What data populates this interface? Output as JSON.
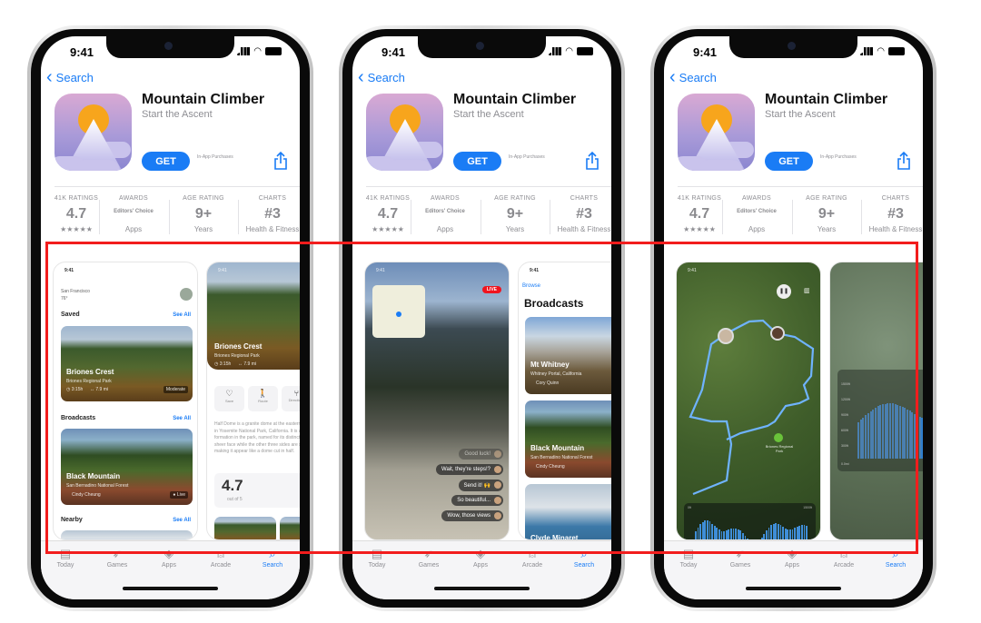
{
  "colors": {
    "accent": "#1a7cf5",
    "highlight_box": "#f21d1d",
    "live": "#f0141e"
  },
  "common": {
    "time": "9:41",
    "back_label": "Search",
    "app_title": "Mountain Climber",
    "app_subtitle": "Start the Ascent",
    "get_label": "GET",
    "in_app_label": "In-App Purchases",
    "ratings": [
      {
        "label": "41K RATINGS",
        "value": "4.7",
        "sub": "★★★★★"
      },
      {
        "label": "AWARDS",
        "value": "Editors' Choice",
        "sub": "Apps"
      },
      {
        "label": "AGE RATING",
        "value": "9+",
        "sub": "Years"
      },
      {
        "label": "CHARTS",
        "value": "#3",
        "sub": "Health & Fitness"
      }
    ],
    "tabs": [
      {
        "label": "Today",
        "icon": "today-icon",
        "glyph": "▤"
      },
      {
        "label": "Games",
        "icon": "rocket-icon",
        "glyph": "➶"
      },
      {
        "label": "Apps",
        "icon": "apps-stack-icon",
        "glyph": "◈"
      },
      {
        "label": "Arcade",
        "icon": "arcade-joystick-icon",
        "glyph": "⍝"
      },
      {
        "label": "Search",
        "icon": "search-icon",
        "glyph": "⌕",
        "active": true
      }
    ]
  },
  "phones": [
    {
      "type": "discover",
      "shot_a": {
        "time": "9:41",
        "location": "San Francisco",
        "temp": "76°",
        "sections": [
          {
            "title": "Saved",
            "see_all": "See All"
          },
          {
            "title": "Broadcasts",
            "see_all": "See All"
          },
          {
            "title": "Nearby",
            "see_all": "See All"
          }
        ],
        "card1": {
          "name": "Briones Crest",
          "park": "Briones Regional Park",
          "duration": "◷ 3:15h",
          "distance": "↔ 7.9 mi",
          "badge": "Moderate"
        },
        "card2": {
          "name": "Black Mountain",
          "park": "San Bernadino National Forest",
          "user": "Cindy Cheung",
          "badge": "● Live"
        }
      },
      "shot_b": {
        "time": "9:41",
        "name": "Briones Crest",
        "park": "Briones Regional Park",
        "duration": "◷ 3:15h",
        "distance": "↔ 7.9 mi",
        "actions": [
          "Save",
          "Route",
          "Directions"
        ],
        "description": "Half Dome is a granite dome at the eastern end of Yosemite Valley in Yosemite National Park, California. It is a well-known rock formation in the park, named for its distinct shape. One side is a sheer face while the other three sides are smooth and round, making it appear like a dome cut in half.",
        "score": "4.7",
        "score_sub": "out of 5"
      }
    },
    {
      "type": "live",
      "shot_a": {
        "time": "9:41",
        "live": "LIVE",
        "messages": [
          "Good luck!",
          "Wait, they're steps!?",
          "Send it! 🙌",
          "So beautiful...",
          "Wow, those views"
        ]
      },
      "shot_b": {
        "time": "9:41",
        "back": "Browse",
        "title": "Broadcasts",
        "cards": [
          {
            "name": "Mt Whitney",
            "place": "Whitney Portal, California",
            "user": "Cory Quinn"
          },
          {
            "name": "Black Mountain",
            "place": "San Bernadino National Forest",
            "user": "Cindy Cheung"
          },
          {
            "name": "Clyde Minaret",
            "place": "",
            "user": ""
          }
        ]
      }
    },
    {
      "type": "map",
      "shot_a": {
        "time": "9:41",
        "poi": "Briones Regional Park",
        "chart_left": "0ft",
        "chart_right": "1500ft"
      },
      "shot_b": {
        "axis": [
          "1500ft",
          "1200ft",
          "900ft",
          "600ft",
          "300ft"
        ],
        "xlabel": "0.0mi"
      }
    }
  ]
}
